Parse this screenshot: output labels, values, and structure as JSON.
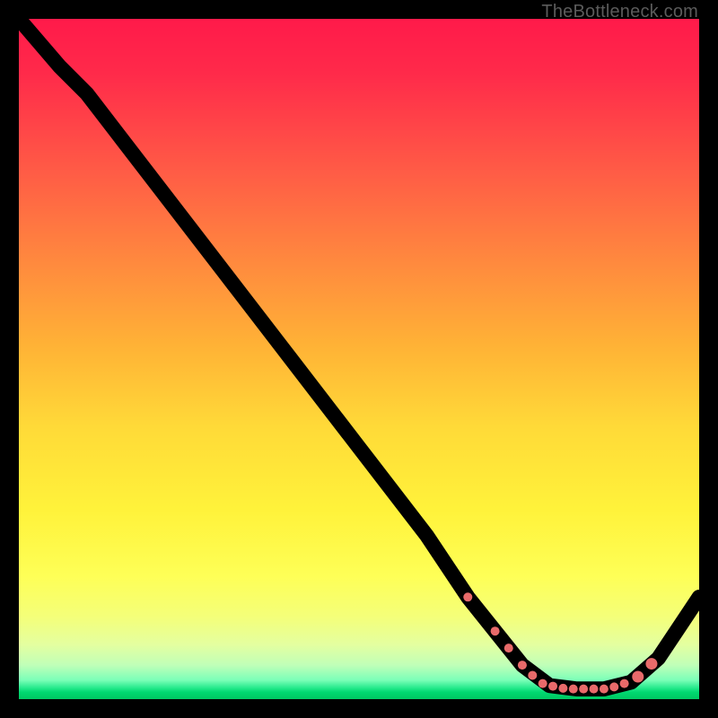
{
  "watermark": "TheBottleneck.com",
  "colors": {
    "frame_bg": "#000000",
    "curve": "#000000",
    "marker": "#e86a6a"
  },
  "chart_data": {
    "type": "line",
    "title": "",
    "xlabel": "",
    "ylabel": "",
    "xlim": [
      0,
      100
    ],
    "ylim": [
      0,
      100
    ],
    "grid": false,
    "legend": false,
    "series": [
      {
        "name": "bottleneck-curve",
        "x": [
          0,
          6,
          10,
          20,
          30,
          40,
          50,
          60,
          66,
          70,
          74,
          78,
          82,
          86,
          90,
          94,
          100
        ],
        "y": [
          100,
          93,
          89,
          76,
          63,
          50,
          37,
          24,
          15,
          10,
          5,
          2,
          1.5,
          1.5,
          2.5,
          6,
          15
        ]
      }
    ],
    "markers": {
      "name": "highlight-points",
      "x": [
        66,
        70,
        72,
        74,
        75.5,
        77,
        78.5,
        80,
        81.5,
        83,
        84.5,
        86,
        87.5,
        89,
        91,
        93
      ],
      "y": [
        15,
        10,
        7.5,
        5,
        3.5,
        2.3,
        1.9,
        1.6,
        1.5,
        1.5,
        1.5,
        1.5,
        1.8,
        2.3,
        3.3,
        5.2
      ],
      "r": [
        5,
        5,
        5,
        5,
        5,
        5,
        5,
        5,
        5,
        5,
        5,
        5,
        5,
        5,
        6.5,
        6.5
      ]
    }
  }
}
